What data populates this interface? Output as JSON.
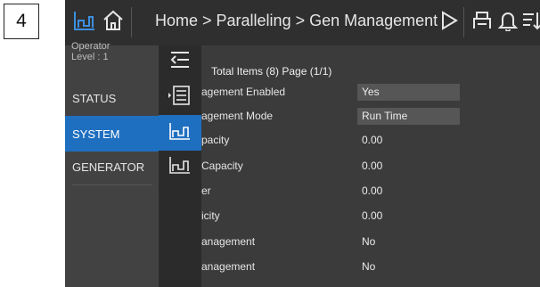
{
  "callout": {
    "label": "4"
  },
  "topbar": {
    "breadcrumb": "Home > Paralleling > Gen Management > Stat",
    "icons": [
      "chart-icon",
      "home-icon",
      "play-icon",
      "printer-icon",
      "bell-icon",
      "sort-icon"
    ],
    "accent": "#1f6fc0"
  },
  "sidebar": {
    "operator_line1": "Operator",
    "operator_line2": "Level : 1",
    "items": [
      {
        "label": "STATUS",
        "active": false
      },
      {
        "label": "SYSTEM",
        "active": true
      },
      {
        "label": "GENERATOR",
        "active": false
      }
    ]
  },
  "flyout": {
    "icons": [
      "collapse-icon",
      "list-icon",
      "chart-icon",
      "chart-icon"
    ],
    "active_index": 2
  },
  "content": {
    "total_items": "Total Items (8) Page (1/1)",
    "rows": [
      {
        "label": "agement Enabled",
        "value": "Yes"
      },
      {
        "label": "agement Mode",
        "value": "Run Time"
      },
      {
        "label": "pacity",
        "value": "0.00"
      },
      {
        "label": "Capacity",
        "value": "0.00"
      },
      {
        "label": "er",
        "value": "0.00"
      },
      {
        "label": "icity",
        "value": "0.00"
      },
      {
        "label": "anagement",
        "value": "No"
      },
      {
        "label": "anagement",
        "value": "No"
      }
    ]
  },
  "colors": {
    "background": "#3b3b3b",
    "sidebar": "#424242",
    "value_box": "#565656",
    "highlight": "#1f6fc0"
  }
}
